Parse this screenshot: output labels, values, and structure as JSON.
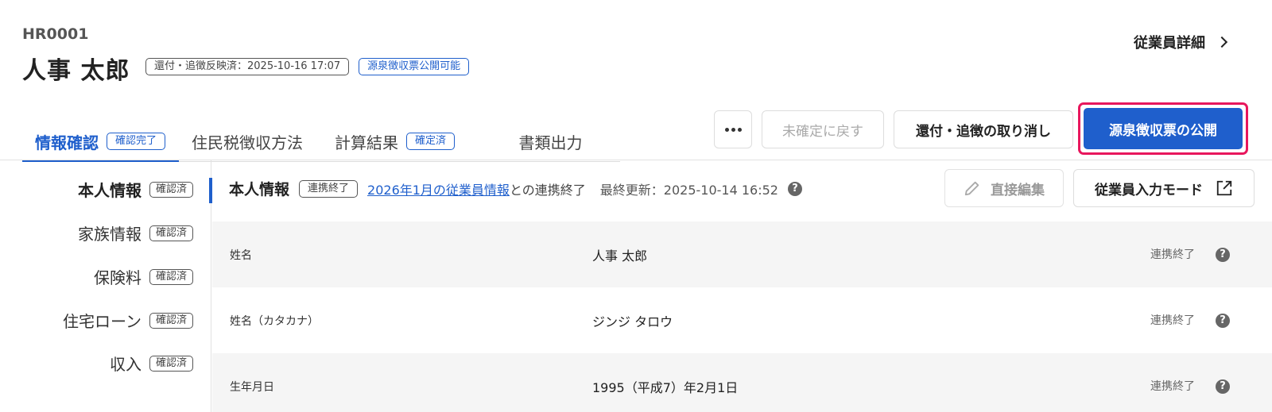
{
  "header": {
    "employee_id": "HR0001",
    "employee_name": "人事 太郎",
    "badges": [
      "還付・追徴反映済：2025-10-16 17:07",
      "源泉徴収票公開可能"
    ],
    "detail_link": "従業員詳細"
  },
  "tabs": [
    {
      "label": "情報確認",
      "badge": "確認完了",
      "active": true
    },
    {
      "label": "住民税徴収方法",
      "badge": ""
    },
    {
      "label": "計算結果",
      "badge": "確定済"
    },
    {
      "label": "書類出力",
      "badge": ""
    }
  ],
  "actions": {
    "more_icon": "more-dots-icon",
    "revert": "未確定に戻す",
    "cancel_refund": "還付・追徴の取り消し",
    "publish": "源泉徴収票の公開"
  },
  "sidenav": {
    "items": [
      {
        "label": "本人情報",
        "badge": "確認済",
        "active": true
      },
      {
        "label": "家族情報",
        "badge": "確認済"
      },
      {
        "label": "保険料",
        "badge": "確認済"
      },
      {
        "label": "住宅ローン",
        "badge": "確認済"
      },
      {
        "label": "収入",
        "badge": "確認済"
      }
    ]
  },
  "section": {
    "title": "本人情報",
    "badge": "連携終了",
    "link": "2026年1月の従業員情報",
    "link_suffix": "との連携終了",
    "updated": "最終更新：2025-10-14 16:52",
    "help": "?",
    "edit_button": "直接編集",
    "mode_button": "従業員入力モード"
  },
  "rows": [
    {
      "label": "姓名",
      "value": "人事 太郎",
      "status": "連携終了"
    },
    {
      "label": "姓名（カタカナ）",
      "value": "ジンジ タロウ",
      "status": "連携終了"
    },
    {
      "label": "生年月日",
      "value": "1995（平成7）年2月1日",
      "status": "連携終了"
    }
  ],
  "colors": {
    "accent": "#1f5fcc",
    "highlight": "#e8175d"
  }
}
